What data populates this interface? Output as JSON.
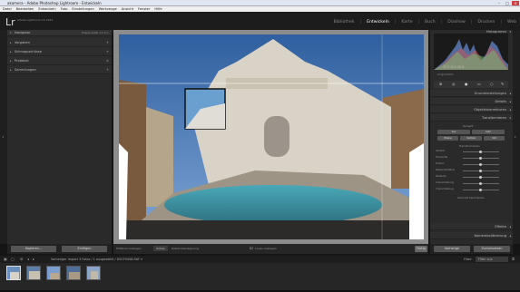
{
  "window": {
    "title": "akamera - Adobe Photoshop Lightroom - Entwickeln"
  },
  "menu": [
    "Datei",
    "Bearbeiten",
    "Entwickeln",
    "Foto",
    "Einstellungen",
    "Werkzeuge",
    "Ansicht",
    "Fenster",
    "Hilfe"
  ],
  "identity": {
    "logo": "Lr",
    "catalog": "Adobe Lightroom CC 2015"
  },
  "modules": [
    "Bibliothek",
    "Entwickeln",
    "Karte",
    "Buch",
    "Diashow",
    "Drucken",
    "Web"
  ],
  "left_panel": {
    "navigator": {
      "label": "Navigator",
      "zoom": "Einpas  Ausfü  1:1  1:1"
    },
    "sections": [
      "Vorgaben",
      "Schnappschüsse",
      "Protokoll",
      "Sammlungen"
    ],
    "buttons": {
      "copy": "Kopieren...",
      "paste": "Einfügen"
    }
  },
  "right_panel": {
    "histogram_label": "Histogramm",
    "histogram_readout": "47.3   14.0   63.8",
    "original_photo": "Originalfoto",
    "sections": [
      "Grundeinstellungen",
      "Details",
      "Objektivkorrekturen",
      "Transformieren",
      "Effekte",
      "Kamerakalibrierung"
    ],
    "transform": {
      "upright_label": "Upright",
      "upright_buttons": [
        "Aus",
        "Auto",
        "Ebene",
        "Vertikal",
        "Voll"
      ],
      "transform_label": "Transformieren",
      "sliders": [
        "Vertikal",
        "Horizontal",
        "Drehen",
        "Seitenverhältnis",
        "Skalieren",
        "X-Verschiebung",
        "Y-Verschiebung"
      ],
      "constrain": "Zuschnitt beschränken"
    },
    "buttons": {
      "previous": "Vorherige",
      "reset": "Zurücksetzen"
    }
  },
  "toolbar": {
    "upright_grid": "Hilfslinie Anzeigen",
    "grid_value": "Immer",
    "lens": "Rasterüberlagerung",
    "loupe": "Loupe anzeigen",
    "done": "Fertig"
  },
  "filmstrip": {
    "path": "Vorheriger Import   3 Fotos / 1 ausgewählt / DSCF0008.RAF ▾",
    "filter_label": "Filter:",
    "filter_value": "Filter aus"
  },
  "colors": {
    "accent": "#dddddd",
    "panel": "#2a2a2a",
    "background": "#151515"
  }
}
